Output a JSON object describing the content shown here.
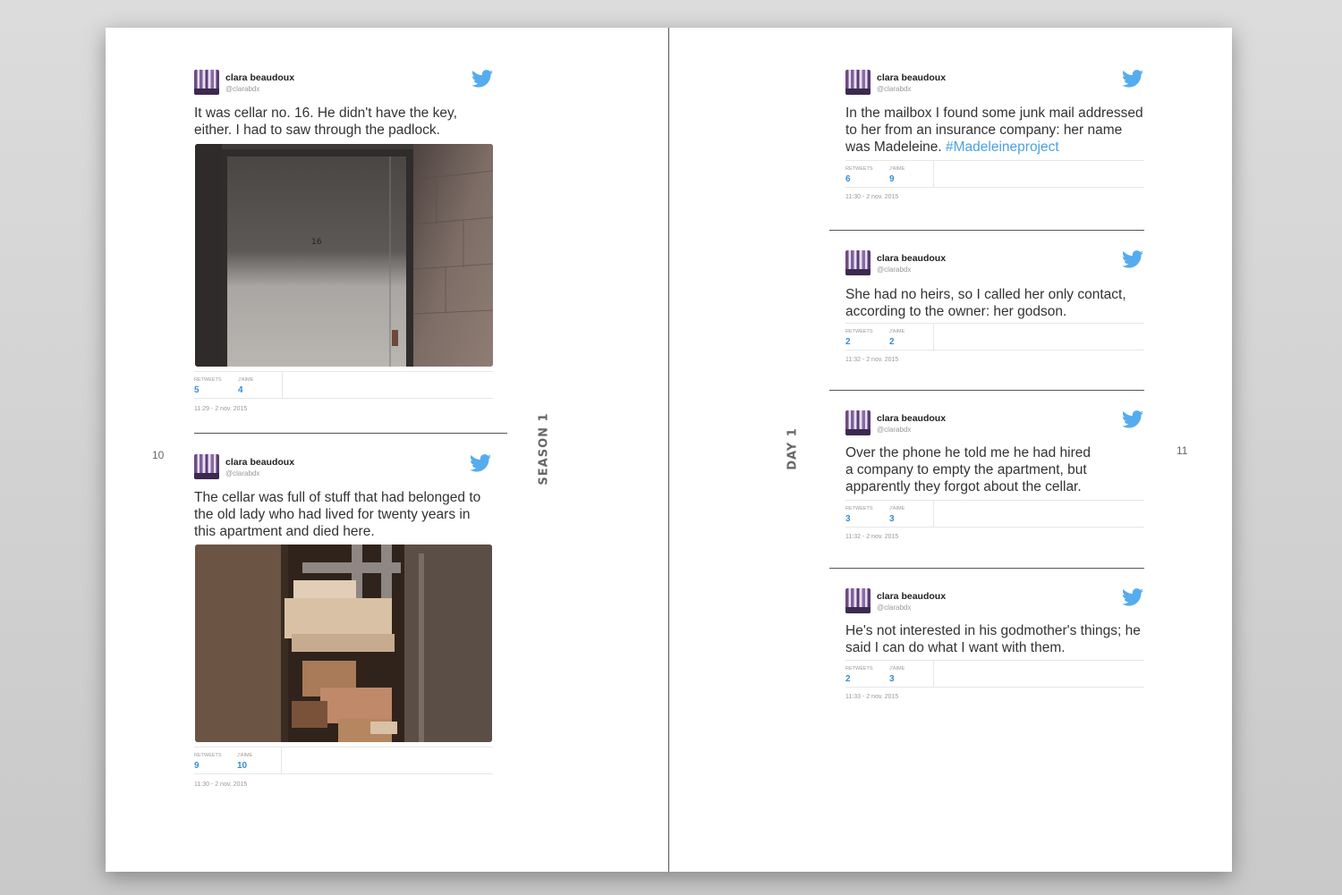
{
  "left_page": {
    "page_number": "10",
    "side_label": "SEASON 1",
    "tweets": [
      {
        "name": "clara beaudoux",
        "handle": "@clarabdx",
        "text": "It was cellar no. 16. He didn't have the key, either. I had to saw through the padlock.",
        "photo": "cellar door with number 16 and padlock",
        "door_number": "16",
        "retweets_label": "RETWEETS",
        "retweets": "5",
        "likes_label": "J'AIME",
        "likes": "4",
        "date": "11:29 - 2 nov. 2015"
      },
      {
        "name": "clara beaudoux",
        "handle": "@clarabdx",
        "text": "The cellar was full of stuff that had belonged to the old lady who had lived for twenty years in this apartment and died here.",
        "photo": "cluttered cellar with boxes and pipes",
        "retweets_label": "RETWEETS",
        "retweets": "9",
        "likes_label": "J'AIME",
        "likes": "10",
        "date": "11:30 - 2 nov. 2015"
      }
    ]
  },
  "right_page": {
    "page_number": "11",
    "side_label": "DAY 1",
    "tweets": [
      {
        "name": "clara beaudoux",
        "handle": "@clarabdx",
        "text": "In the mailbox I found some junk mail addressed to her from an insurance company: her name was Madeleine.",
        "hashtag": "#Madeleineproject",
        "retweets_label": "RETWEETS",
        "retweets": "6",
        "likes_label": "J'AIME",
        "likes": "9",
        "date": "11:30 - 2 nov. 2015"
      },
      {
        "name": "clara beaudoux",
        "handle": "@clarabdx",
        "text": "She had no heirs, so I called her only contact, according to the owner: her godson.",
        "retweets_label": "RETWEETS",
        "retweets": "2",
        "likes_label": "J'AIME",
        "likes": "2",
        "date": "11:32 - 2 nov. 2015"
      },
      {
        "name": "clara beaudoux",
        "handle": "@clarabdx",
        "text": "Over the phone he told me he had hired a company to empty the apartment, but apparently they forgot about the cellar.",
        "retweets_label": "RETWEETS",
        "retweets": "3",
        "likes_label": "J'AIME",
        "likes": "3",
        "date": "11:32 - 2 nov. 2015"
      },
      {
        "name": "clara beaudoux",
        "handle": "@clarabdx",
        "text": "He's not interested in his godmother's things; he said I can do what I want with them.",
        "retweets_label": "RETWEETS",
        "retweets": "2",
        "likes_label": "J'AIME",
        "likes": "3",
        "date": "11:33 - 2 nov. 2015"
      }
    ]
  },
  "colors": {
    "twitter_blue": "#55acee",
    "link_blue": "#4aa3df",
    "stat_blue": "#3a8dd0",
    "text": "#333333"
  },
  "icons": {
    "tweet_logo": "twitter-bird-icon",
    "avatar": "user-avatar"
  }
}
